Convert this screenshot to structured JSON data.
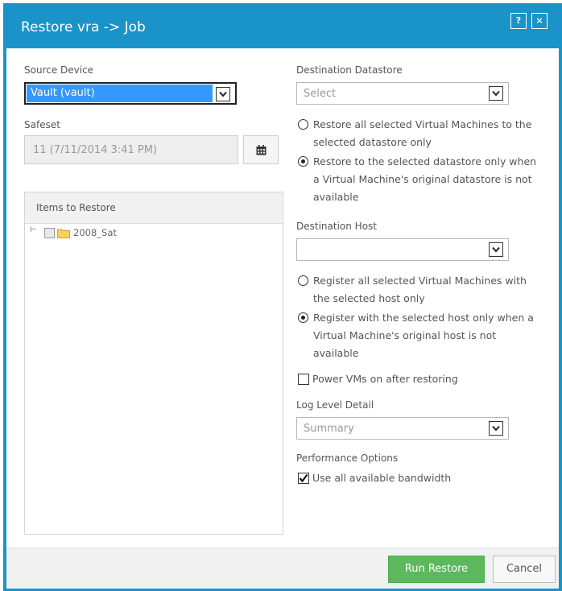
{
  "window": {
    "title": "Restore vra -> Job",
    "help_label": "?",
    "close_label": "×"
  },
  "left": {
    "source_device_label": "Source Device",
    "source_device_value": "Vault (vault)",
    "safeset_label": "Safeset",
    "safeset_value": "11 (7/11/2014 3:41 PM)",
    "items_header": "Items to Restore",
    "tree": [
      {
        "expander": "⊢",
        "label": "2008_Sat"
      }
    ]
  },
  "right": {
    "dest_datastore_label": "Destination Datastore",
    "dest_datastore_value": "Select",
    "datastore_options": [
      {
        "line1": "Restore all selected Virtual Machines to the",
        "line2": "selected datastore only",
        "line3": "",
        "selected": false
      },
      {
        "line1": "Restore to the selected datastore only when",
        "line2": "a Virtual Machine's original datastore is not",
        "line3": "available",
        "selected": true
      }
    ],
    "dest_host_label": "Destination Host",
    "dest_host_value": "",
    "host_options": [
      {
        "line1": "Register all selected Virtual Machines with",
        "line2": "the selected host only",
        "line3": "",
        "selected": false
      },
      {
        "line1": "Register with the selected host only when a",
        "line2": "Virtual Machine's original host is not",
        "line3": "available",
        "selected": true
      }
    ],
    "power_on_label": "Power VMs on after restoring",
    "power_on_checked": false,
    "log_level_label": "Log Level Detail",
    "log_level_value": "Summary",
    "performance_label": "Performance Options",
    "bandwidth_label": "Use all available bandwidth",
    "bandwidth_checked": true
  },
  "footer": {
    "run_label": "Run Restore",
    "cancel_label": "Cancel"
  },
  "colors": {
    "brand_blue": "#1a93c9",
    "run_green": "#5cb85c",
    "selection_blue": "#3399ff"
  }
}
